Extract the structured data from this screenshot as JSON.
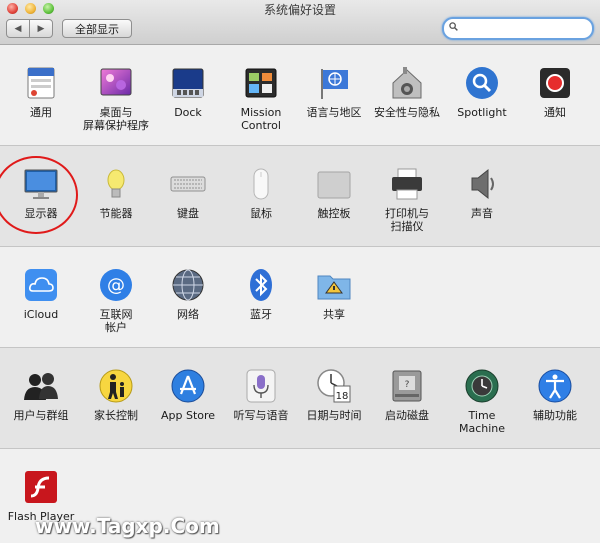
{
  "window": {
    "title": "系统偏好设置"
  },
  "toolbar": {
    "back": "◀",
    "forward": "▶",
    "show_all": "全部显示",
    "search_placeholder": ""
  },
  "rows": [
    [
      {
        "id": "general",
        "label": "通用",
        "icon": "general-icon"
      },
      {
        "id": "desktop",
        "label": "桌面与\n屏幕保护程序",
        "icon": "desktop-screensaver-icon"
      },
      {
        "id": "dock",
        "label": "Dock",
        "icon": "dock-icon"
      },
      {
        "id": "mission",
        "label": "Mission\nControl",
        "icon": "mission-control-icon"
      },
      {
        "id": "language",
        "label": "语言与地区",
        "icon": "language-region-icon"
      },
      {
        "id": "security",
        "label": "安全性与隐私",
        "icon": "security-privacy-icon"
      },
      {
        "id": "spotlight",
        "label": "Spotlight",
        "icon": "spotlight-icon"
      },
      {
        "id": "notifications",
        "label": "通知",
        "icon": "notifications-icon"
      }
    ],
    [
      {
        "id": "displays",
        "label": "显示器",
        "icon": "displays-icon"
      },
      {
        "id": "energy",
        "label": "节能器",
        "icon": "energy-saver-icon"
      },
      {
        "id": "keyboard",
        "label": "键盘",
        "icon": "keyboard-icon"
      },
      {
        "id": "mouse",
        "label": "鼠标",
        "icon": "mouse-icon"
      },
      {
        "id": "trackpad",
        "label": "触控板",
        "icon": "trackpad-icon"
      },
      {
        "id": "printers",
        "label": "打印机与\n扫描仪",
        "icon": "printer-scanner-icon"
      },
      {
        "id": "sound",
        "label": "声音",
        "icon": "sound-icon"
      }
    ],
    [
      {
        "id": "icloud",
        "label": "iCloud",
        "icon": "icloud-icon"
      },
      {
        "id": "internet",
        "label": "互联网\n帐户",
        "icon": "internet-accounts-icon"
      },
      {
        "id": "network",
        "label": "网络",
        "icon": "network-icon"
      },
      {
        "id": "bluetooth",
        "label": "蓝牙",
        "icon": "bluetooth-icon"
      },
      {
        "id": "sharing",
        "label": "共享",
        "icon": "sharing-icon"
      }
    ],
    [
      {
        "id": "users",
        "label": "用户与群组",
        "icon": "users-groups-icon"
      },
      {
        "id": "parental",
        "label": "家长控制",
        "icon": "parental-controls-icon"
      },
      {
        "id": "appstore",
        "label": "App Store",
        "icon": "app-store-icon"
      },
      {
        "id": "dictation",
        "label": "听写与语音",
        "icon": "dictation-speech-icon"
      },
      {
        "id": "datetime",
        "label": "日期与时间",
        "icon": "date-time-icon"
      },
      {
        "id": "startup",
        "label": "启动磁盘",
        "icon": "startup-disk-icon"
      },
      {
        "id": "timemachine",
        "label": "Time Machine",
        "icon": "time-machine-icon"
      },
      {
        "id": "accessibility",
        "label": "辅助功能",
        "icon": "accessibility-icon"
      }
    ],
    [
      {
        "id": "flash",
        "label": "Flash Player",
        "icon": "flash-player-icon"
      }
    ]
  ],
  "watermark": "www.Tagxp.Com"
}
